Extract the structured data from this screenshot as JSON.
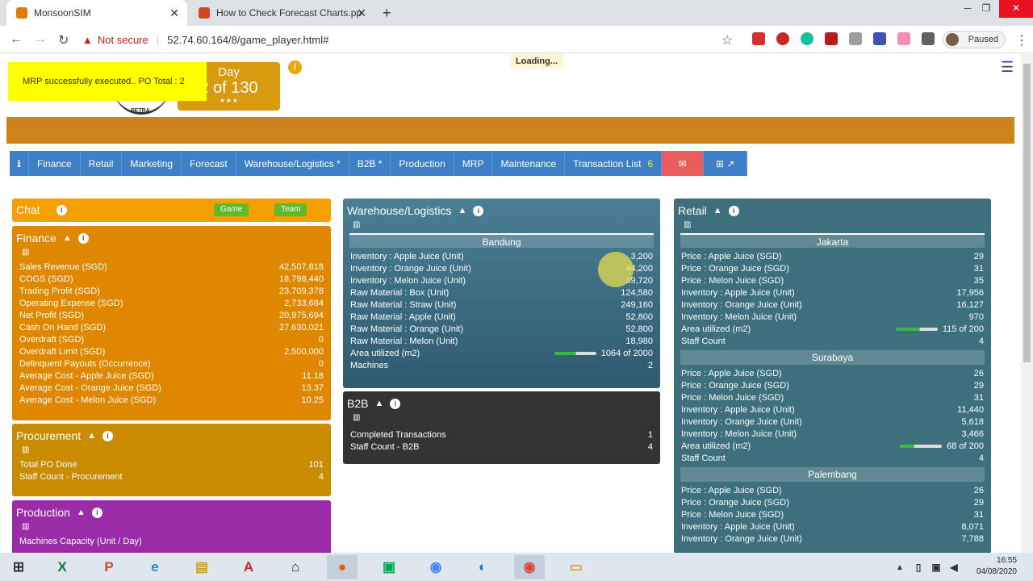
{
  "browser": {
    "tabs": [
      {
        "title": "MonsoonSIM"
      },
      {
        "title": "How to Check Forecast Charts.pp"
      }
    ],
    "new_tab": "+",
    "not_secure": "Not secure",
    "url": "52.74.60.164/8/game_player.html#",
    "profile": "Paused"
  },
  "toast": "MRP successfully executed.. PO Total : 2",
  "logo_text": "PETRA",
  "day": {
    "label": "Day",
    "value": "2 of 130"
  },
  "loading": "Loading...",
  "nav": [
    {
      "label": "Finance"
    },
    {
      "label": "Retail"
    },
    {
      "label": "Marketing"
    },
    {
      "label": "Forecast"
    },
    {
      "label": "Warehouse/Logistics *"
    },
    {
      "label": "B2B *"
    },
    {
      "label": "Production"
    },
    {
      "label": "MRP"
    },
    {
      "label": "Maintenance"
    },
    {
      "label": "Transaction List",
      "count": "6"
    }
  ],
  "chat": {
    "title": "Chat",
    "game": "Game",
    "team": "Team"
  },
  "finance": {
    "title": "Finance",
    "rows": [
      [
        "Sales Revenue (SGD)",
        "42,507,818"
      ],
      [
        "COGS (SGD)",
        "18,798,440"
      ],
      [
        "Trading Profit (SGD)",
        "23,709,378"
      ],
      [
        "Operating Expense (SGD)",
        "2,733,684"
      ],
      [
        "Net Profit (SGD)",
        "20,975,694"
      ],
      [
        "Cash On Hand (SGD)",
        "27,630,021"
      ],
      [
        "Overdraft (SGD)",
        "0"
      ],
      [
        "Overdraft Limit (SGD)",
        "2,500,000"
      ],
      [
        "Delinquent Payouts (Occurrence)",
        "0"
      ],
      [
        "Average Cost - Apple Juice (SGD)",
        "11.18"
      ],
      [
        "Average Cost - Orange Juice (SGD)",
        "13.37"
      ],
      [
        "Average Cost - Melon Juice (SGD)",
        "10.25"
      ]
    ]
  },
  "procurement": {
    "title": "Procurement",
    "rows": [
      [
        "Total PO Done",
        "101"
      ],
      [
        "Staff Count - Procurement",
        "4"
      ]
    ]
  },
  "production": {
    "title": "Production",
    "rows": [
      [
        "Machines Capacity (Unit / Day)",
        ""
      ]
    ]
  },
  "warehouse": {
    "title": "Warehouse/Logistics",
    "location": "Bandung",
    "rows": [
      [
        "Inventory : Apple Juice (Unit)",
        "3,200"
      ],
      [
        "Inventory : Orange Juice (Unit)",
        "44,200"
      ],
      [
        "Inventory : Melon Juice (Unit)",
        "39,720"
      ],
      [
        "Raw Material : Box (Unit)",
        "124,580"
      ],
      [
        "Raw Material : Straw (Unit)",
        "249,160"
      ],
      [
        "Raw Material : Apple (Unit)",
        "52,800"
      ],
      [
        "Raw Material : Orange (Unit)",
        "52,800"
      ],
      [
        "Raw Material : Melon (Unit)",
        "18,980"
      ]
    ],
    "area_label": "Area utilized (m2)",
    "area_value": "1064 of 2000",
    "area_fraction": 0.532,
    "machines_label": "Machines",
    "machines_value": "2"
  },
  "b2b": {
    "title": "B2B",
    "rows": [
      [
        "Completed Transactions",
        "1"
      ],
      [
        "Staff Count - B2B",
        "4"
      ]
    ]
  },
  "retail": {
    "title": "Retail",
    "cities": [
      {
        "name": "Jakarta",
        "rows": [
          [
            "Price : Apple Juice (SGD)",
            "29"
          ],
          [
            "Price : Orange Juice (SGD)",
            "31"
          ],
          [
            "Price : Melon Juice (SGD)",
            "35"
          ],
          [
            "Inventory : Apple Juice (Unit)",
            "17,956"
          ],
          [
            "Inventory : Orange Juice (Unit)",
            "16,127"
          ],
          [
            "Inventory : Melon Juice (Unit)",
            "970"
          ]
        ],
        "area_label": "Area utilized (m2)",
        "area_value": "115 of 200",
        "area_fraction": 0.575,
        "staff_label": "Staff Count",
        "staff_value": "4"
      },
      {
        "name": "Surabaya",
        "rows": [
          [
            "Price : Apple Juice (SGD)",
            "26"
          ],
          [
            "Price : Orange Juice (SGD)",
            "29"
          ],
          [
            "Price : Melon Juice (SGD)",
            "31"
          ],
          [
            "Inventory : Apple Juice (Unit)",
            "11,440"
          ],
          [
            "Inventory : Orange Juice (Unit)",
            "5,618"
          ],
          [
            "Inventory : Melon Juice (Unit)",
            "3,466"
          ]
        ],
        "area_label": "Area utilized (m2)",
        "area_value": "68 of 200",
        "area_fraction": 0.34,
        "staff_label": "Staff Count",
        "staff_value": "4"
      },
      {
        "name": "Palembang",
        "rows": [
          [
            "Price : Apple Juice (SGD)",
            "26"
          ],
          [
            "Price : Orange Juice (SGD)",
            "29"
          ],
          [
            "Price : Melon Juice (SGD)",
            "31"
          ],
          [
            "Inventory : Apple Juice (Unit)",
            "8,071"
          ],
          [
            "Inventory : Orange Juice (Unit)",
            "7,788"
          ]
        ]
      }
    ]
  },
  "clock": {
    "time": "16:55",
    "date": "04/08/2020"
  },
  "colors": {
    "gold": "#cc831b",
    "nav": "#3e7fc6",
    "chat": "#f5a000",
    "finance": "#e08700",
    "procurement": "#c98c00",
    "production": "#9b2ca8",
    "warehouse": "#3d6f86",
    "b2b": "#333333",
    "retail": "#3d6f7d"
  }
}
